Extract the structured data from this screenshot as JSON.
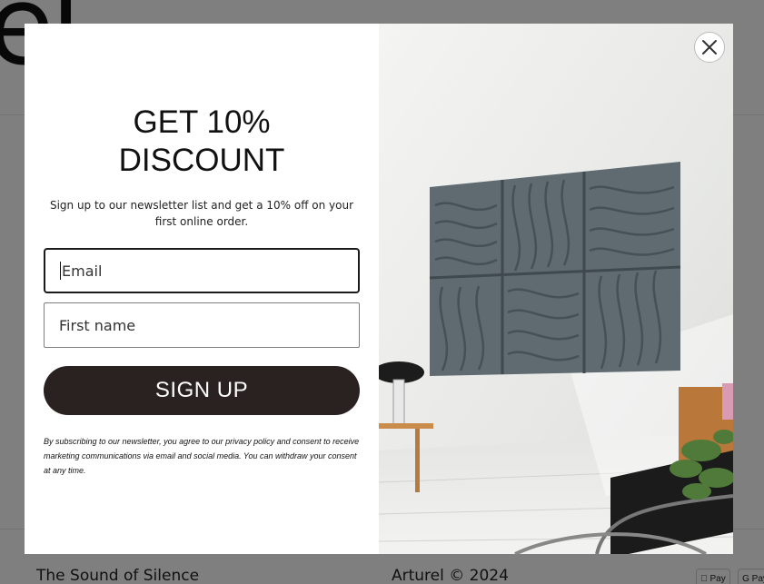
{
  "background": {
    "logo_text": "el",
    "footer_left": "The Sound of Silence",
    "footer_right": "Arturel © 2024",
    "payment_badges": [
      "Pay",
      "G Pay"
    ]
  },
  "popup": {
    "headline_line1": "GET 10%",
    "headline_line2": "DISCOUNT",
    "subtext": "Sign up to our newsletter list and get a 10% off on your first online order.",
    "email_placeholder": "Email",
    "first_name_placeholder": "First name",
    "signup_label": "SIGN UP",
    "disclaimer": "By subscribing to our newsletter, you agree to our privacy policy and consent to receive marketing communications via email and social media. You can withdraw your consent at any time.",
    "close_icon": "close-icon",
    "image_description_icon": "room-photo"
  },
  "colors": {
    "button_bg": "#2a2220",
    "overlay": "rgba(0,0,0,0.5)",
    "wall": "#eeeeec",
    "panels": "#5f6b71"
  }
}
